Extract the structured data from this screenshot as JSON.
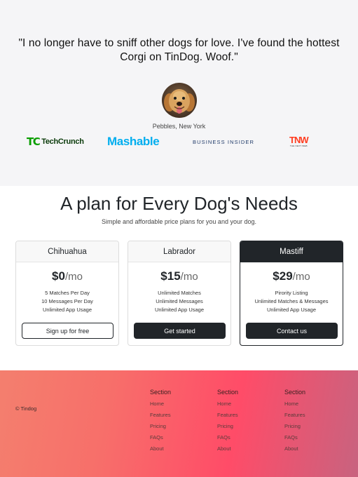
{
  "testimonial": {
    "quote": "\"I no longer have to sniff other dogs for love. I've found the hottest Corgi on TinDog. Woof.\"",
    "author": "Pebbles, New York",
    "avatar_icon": "dog-avatar"
  },
  "press": {
    "techcrunch_mark": "TC",
    "techcrunch_word": "TechCrunch",
    "mashable": "Mashable",
    "business_insider": "BUSINESS INSIDER",
    "tnw_mark": "TNW",
    "tnw_sub": "THE NEXT WEB"
  },
  "pricing": {
    "title": "A plan for Every Dog's Needs",
    "subtitle": "Simple and affordable price plans for you and your dog.",
    "plans": [
      {
        "name": "Chihuahua",
        "price": "$0",
        "per": "/mo",
        "features": [
          "5 Matches Per Day",
          "10 Messages Per Day",
          "Unlimited App Usage"
        ],
        "button": "Sign up for free"
      },
      {
        "name": "Labrador",
        "price": "$15",
        "per": "/mo",
        "features": [
          "Unlimited Matches",
          "Unlimited Messages",
          "Unlimited App Usage"
        ],
        "button": "Get started"
      },
      {
        "name": "Mastiff",
        "price": "$29",
        "per": "/mo",
        "features": [
          "Pirority Listing",
          "Unlimited Matches & Messages",
          "Unlimited App Usage"
        ],
        "button": "Contact us"
      }
    ]
  },
  "footer": {
    "copyright": "© Tindog",
    "columns": [
      {
        "heading": "Section",
        "links": [
          "Home",
          "Features",
          "Pricing",
          "FAQs",
          "About"
        ]
      },
      {
        "heading": "Section",
        "links": [
          "Home",
          "Features",
          "Pricing",
          "FAQs",
          "About"
        ]
      },
      {
        "heading": "Section",
        "links": [
          "Home",
          "Features",
          "Pricing",
          "FAQs",
          "About"
        ]
      }
    ]
  },
  "colors": {
    "dark": "#212529",
    "testimonial_bg": "#f5f5f7",
    "footer_gradient_start": "#f47f6e",
    "footer_gradient_mid": "#ff4c68",
    "footer_gradient_end": "#c8637f",
    "techcrunch_green": "#0a9e01",
    "mashable_blue": "#00aeef",
    "tnw_red": "#ff3c1f"
  }
}
